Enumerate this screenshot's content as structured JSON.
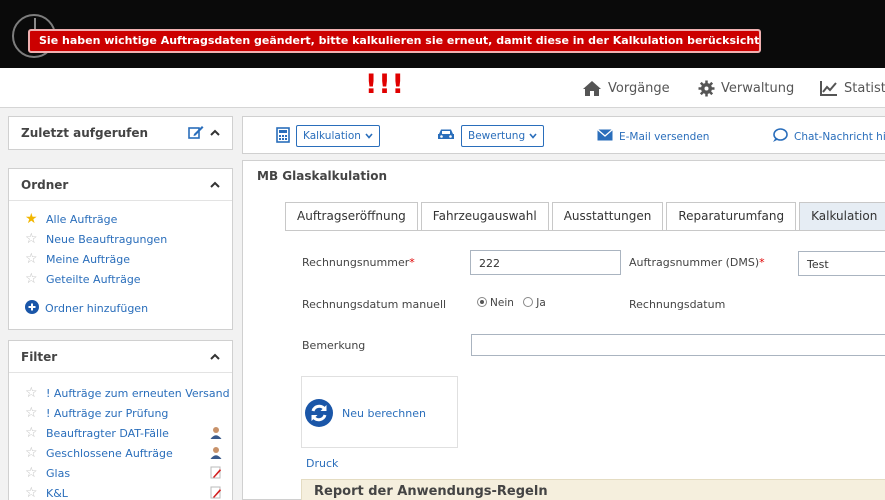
{
  "alert": {
    "message": "Sie haben wichtige Auftragsdaten geändert, bitte kalkulieren sie erneut, damit diese in der Kalkulation berücksichtigt werden können."
  },
  "navbar": {
    "marker": "!!!",
    "items": [
      {
        "label": "Vorgänge",
        "icon": "home-icon"
      },
      {
        "label": "Verwaltung",
        "icon": "gear-icon"
      },
      {
        "label": "Statisti",
        "icon": "chart-icon"
      }
    ]
  },
  "sidebar": {
    "recent": {
      "title": "Zuletzt aufgerufen"
    },
    "folders": {
      "title": "Ordner",
      "items": [
        {
          "label": "Alle Aufträge",
          "starred": true
        },
        {
          "label": "Neue Beauftragungen",
          "starred": false
        },
        {
          "label": "Meine Aufträge",
          "starred": false
        },
        {
          "label": "Geteilte Aufträge",
          "starred": false
        }
      ],
      "add_label": "Ordner hinzufügen"
    },
    "filter": {
      "title": "Filter",
      "items": [
        {
          "label": "! Aufträge zum erneuten Versand",
          "icon": ""
        },
        {
          "label": "! Aufträge zur Prüfung",
          "icon": ""
        },
        {
          "label": "Beauftragter DAT-Fälle",
          "icon": "person-icon"
        },
        {
          "label": "Geschlossene Aufträge",
          "icon": "person-icon"
        },
        {
          "label": "Glas",
          "icon": "edit-doc-icon"
        },
        {
          "label": "K&L",
          "icon": "edit-doc-icon"
        }
      ]
    }
  },
  "toolbar": {
    "kalkulation": "Kalkulation",
    "bewertung": "Bewertung",
    "email": "E-Mail versenden",
    "chat": "Chat-Nachricht hin"
  },
  "main": {
    "title": "MB Glaskalkulation",
    "tabs": [
      {
        "label": "Auftragseröffnung",
        "active": false
      },
      {
        "label": "Fahrzeugauswahl",
        "active": false
      },
      {
        "label": "Ausstattungen",
        "active": false
      },
      {
        "label": "Reparaturumfang",
        "active": false
      },
      {
        "label": "Kalkulation",
        "active": true
      }
    ],
    "form": {
      "rechnungsnummer_label": "Rechnungsnummer",
      "rechnungsnummer_value": "222",
      "auftragsnummer_label": "Auftragsnummer (DMS)",
      "auftragsnummer_value": "Test",
      "rechnungsdatum_manuell_label": "Rechnungsdatum manuell",
      "radio_nein": "Nein",
      "radio_ja": "Ja",
      "radio_selected": "Nein",
      "rechnungsdatum_label": "Rechnungsdatum",
      "bemerkung_label": "Bemerkung",
      "bemerkung_value": ""
    },
    "recalc_label": "Neu berechnen",
    "druck_label": "Druck",
    "report_title": "Report der Anwendungs-Regeln"
  },
  "colors": {
    "accent": "#2a6ebb",
    "alert": "#cc0000",
    "star": "#f2b600"
  }
}
